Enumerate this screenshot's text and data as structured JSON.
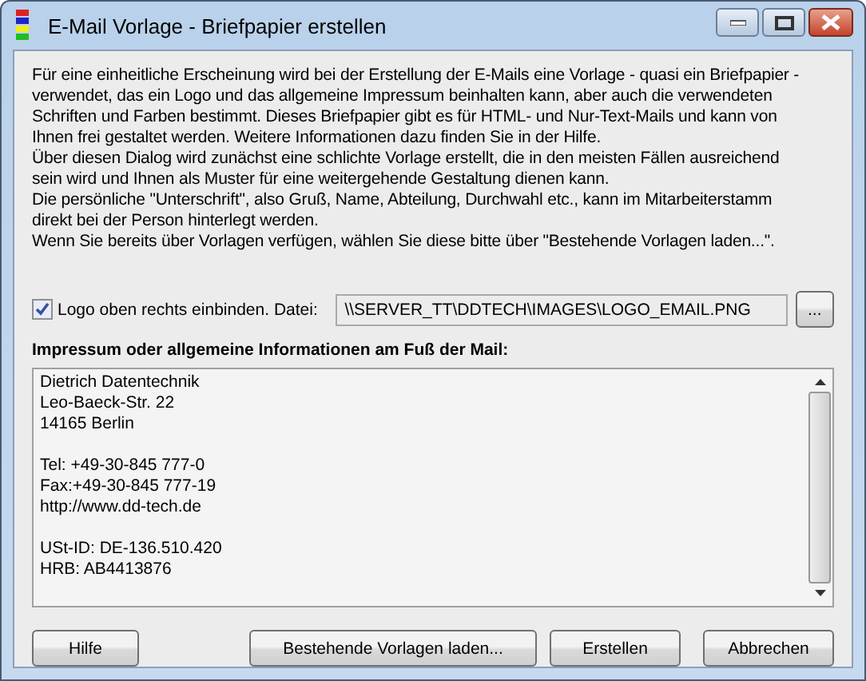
{
  "window": {
    "title": "E-Mail Vorlage - Briefpapier erstellen"
  },
  "intro": [
    "Für eine einheitliche Erscheinung wird bei der Erstellung der E-Mails eine Vorlage - quasi ein Briefpapier -\nverwendet, das ein Logo und das allgemeine Impressum beinhalten kann, aber auch die verwendeten\nSchriften und Farben bestimmt. Dieses Briefpapier gibt es für HTML- und Nur-Text-Mails und kann von\nIhnen frei gestaltet werden. Weitere Informationen dazu finden Sie in der Hilfe.",
    "Über diesen Dialog wird zunächst eine schlichte Vorlage erstellt, die in den meisten Fällen ausreichend\nsein wird und Ihnen als Muster für eine weitergehende Gestaltung dienen kann.",
    "Die persönliche \"Unterschrift\", also Gruß, Name, Abteilung, Durchwahl etc., kann im Mitarbeiterstamm\ndirekt bei der Person hinterlegt werden.",
    "Wenn Sie bereits über Vorlagen verfügen, wählen Sie diese bitte über \"Bestehende Vorlagen laden...\"."
  ],
  "logo": {
    "label": "Logo oben rechts einbinden. Datei:",
    "checked": true,
    "value": "\\\\SERVER_TT\\DDTECH\\IMAGES\\LOGO_EMAIL.PNG",
    "browse": "..."
  },
  "impressum": {
    "label": "Impressum oder allgemeine Informationen am Fuß der Mail:",
    "blocks": [
      [
        "Dietrich Datentechnik",
        "Leo-Baeck-Str. 22",
        "14165 Berlin"
      ],
      [
        "Tel: +49-30-845 777-0",
        "Fax:+49-30-845 777-19",
        "http://www.dd-tech.de"
      ],
      [
        "USt-ID: DE-136.510.420",
        "HRB: AB4413876"
      ]
    ]
  },
  "buttons": [
    {
      "label": "Hilfe",
      "kind": "left"
    },
    {
      "label": "Bestehende Vorlagen laden...",
      "kind": "right"
    },
    {
      "label": "Erstellen",
      "kind": "right"
    },
    {
      "label": "Abbrechen",
      "kind": "right"
    }
  ]
}
